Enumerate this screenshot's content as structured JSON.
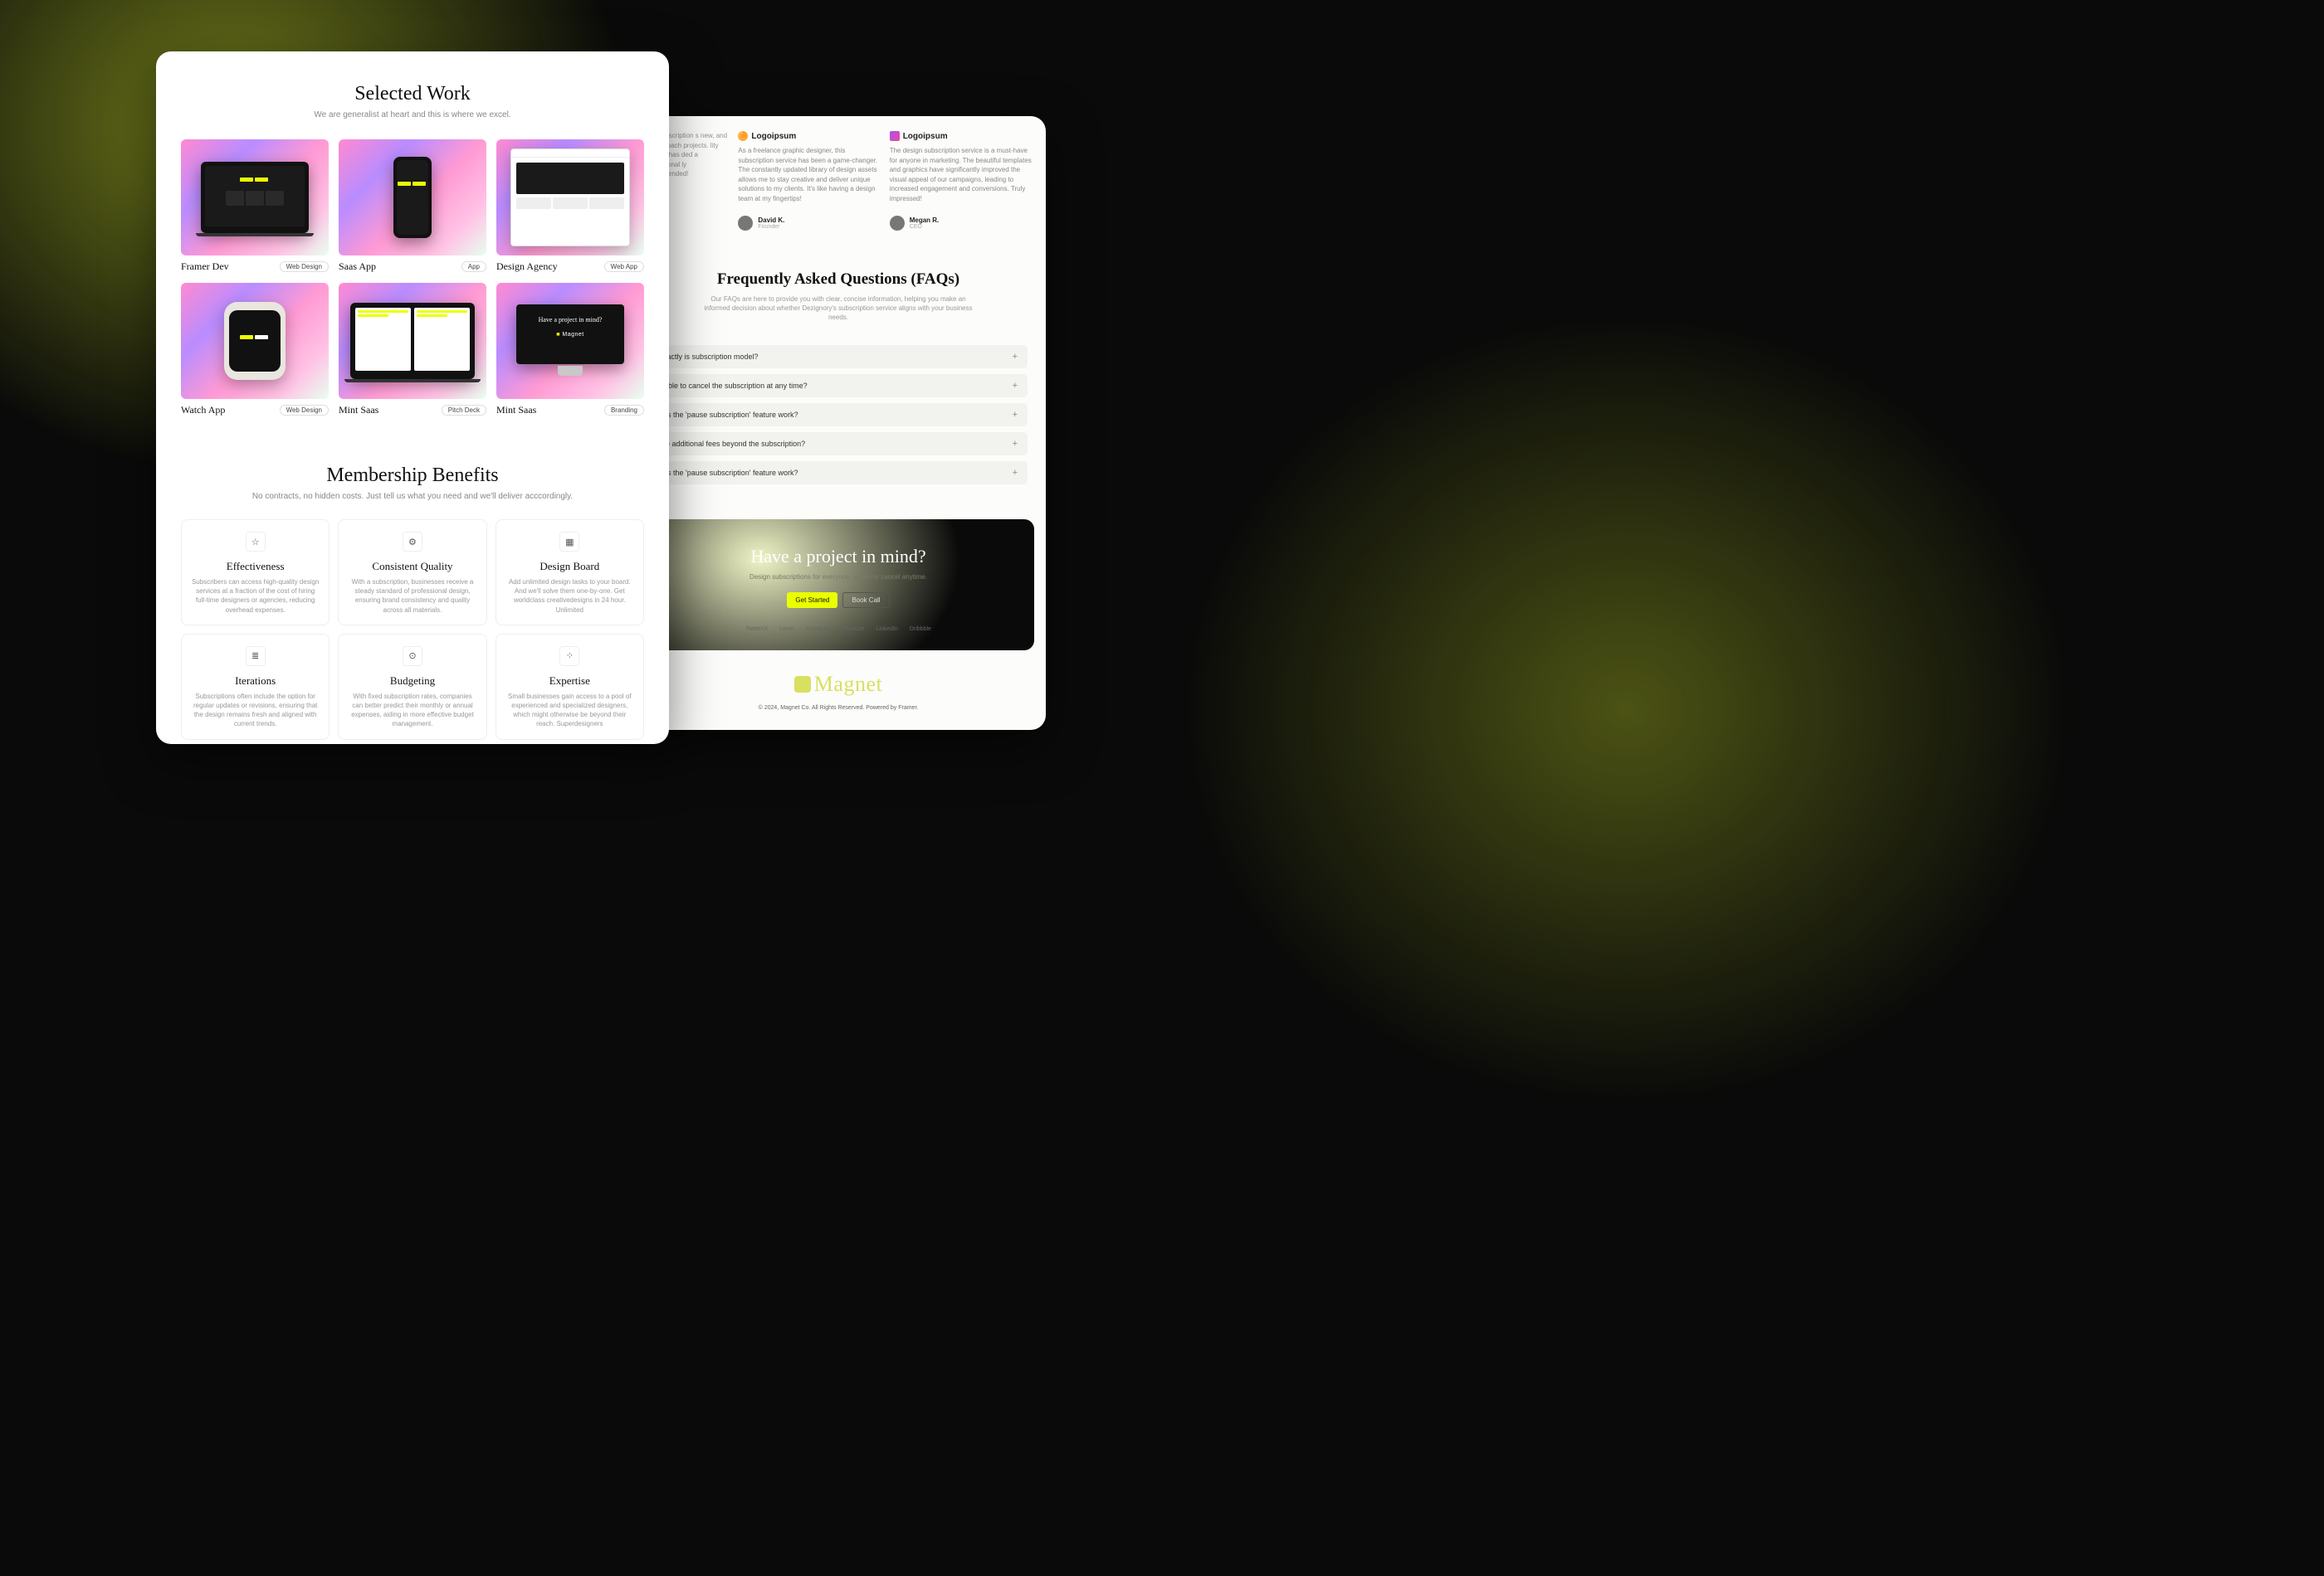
{
  "selected_work": {
    "title": "Selected Work",
    "subtitle": "We are generalist at heart and this is where we excel.",
    "items": [
      {
        "title": "Framer Dev",
        "badge": "Web Design"
      },
      {
        "title": "Saas App",
        "badge": "App"
      },
      {
        "title": "Design Agency",
        "badge": "Web App"
      },
      {
        "title": "Watch App",
        "badge": "Web Design"
      },
      {
        "title": "Mint Saas",
        "badge": "Pitch Deck"
      },
      {
        "title": "Mint Saas",
        "badge": "Branding"
      }
    ],
    "monitor_question": "Have a project in mind?",
    "monitor_brand": "Magnet"
  },
  "benefits": {
    "title": "Membership Benefits",
    "subtitle": "No contracts, no hidden costs. Just tell us what you need and we'll deliver acccordingly.",
    "items": [
      {
        "icon": "star",
        "title": "Effectiveness",
        "desc": "Subscribers can access high-quality design services at a fraction of the cost of hiring full-time designers or agencies, reducing overhead expenses."
      },
      {
        "icon": "cog",
        "title": "Consistent Quality",
        "desc": "With a subscription, businesses receive a steady standard of professional design, ensuring brand consistency and quality across all materials."
      },
      {
        "icon": "board",
        "title": "Design Board",
        "desc": "Add unlimited design tasks to your board. And we'll solve them one-by-one. Get worldclass creativedesigns  in 24 hour. Unlimited"
      },
      {
        "icon": "layers",
        "title": "Iterations",
        "desc": "Subscriptions often include the option for regular updates or revisions, ensuring that the design remains fresh and aligned with current trends."
      },
      {
        "icon": "money",
        "title": "Budgeting",
        "desc": "With fixed subscription rates, companies can better predict their monthly or annual expenses, aiding in more effective budget management."
      },
      {
        "icon": "grid",
        "title": "Expertise",
        "desc": "Small businesses gain access to a pool of experienced and specialized designers, which might otherwise be beyond their reach. Superdesigners"
      }
    ]
  },
  "testimonials": {
    "partial_text": "sign subscription s new, and it's approach projects. lity designs has ded a professional ly recommended!",
    "items": [
      {
        "brand": "Logoipsum",
        "text": "As a freelance graphic designer, this subscription service has been a game-changer. The constantly updated library of design assets allows me to stay creative and deliver unique solutions to my clients. It's like having a design team at my fingertips!",
        "name": "David K.",
        "role": "Founder"
      },
      {
        "brand": "Logoipsum",
        "text": "The design subscription service is a must-have for anyone in marketing. The beautiful templates and graphics have significantly improved the visual appeal of our campaigns, leading to increased engagement and conversions. Truly impressed!",
        "name": "Megan R.",
        "role": "CEO"
      }
    ]
  },
  "faq": {
    "title": "Frequently Asked Questions (FAQs)",
    "subtitle": "Our FAQs are here to provide you with clear, concise information, helping you make an informed decision about whether Dezignory's subscription service aligns with your business needs.",
    "items": [
      "exactly is subscription model?",
      "ssible to cancel the subscription at any time?",
      "oes the 'pause subscription' feature work?",
      "ere additional fees beyond the subscription?",
      "oes the 'pause subscription' feature work?"
    ]
  },
  "cta": {
    "heading": "Have a project in mind?",
    "sub": "Design subscriptions for everyone, pause or cancel anytime.",
    "primary": "Get Started",
    "secondary": "Book Call",
    "links": [
      "Twitter/X",
      "Lemn",
      "Instagram",
      "Youtube",
      "LinkedIn",
      "Dribbble"
    ]
  },
  "footer": {
    "brand": "Magnet",
    "copyright": "© 2024, Magnet Co. All Rights Reserved. Powered by Framer."
  },
  "icon_glyphs": {
    "star": "☆",
    "cog": "⚙",
    "board": "▦",
    "layers": "≣",
    "money": "⊙",
    "grid": "⁘"
  }
}
